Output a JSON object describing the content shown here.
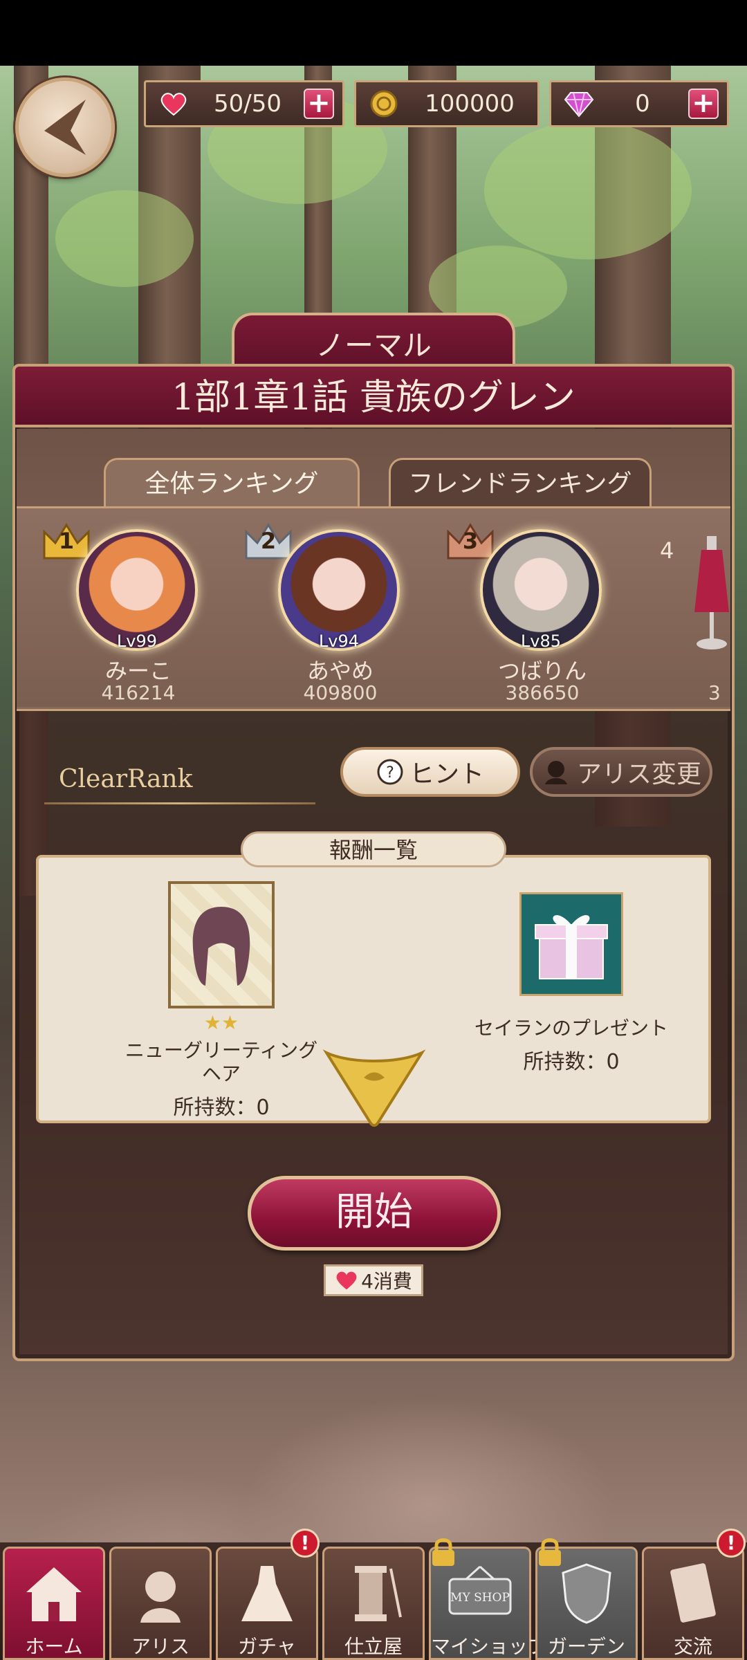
{
  "header": {
    "stamina": "50/50",
    "coins": "100000",
    "gems": "0"
  },
  "stage": {
    "difficulty": "ノーマル",
    "title": "1部1章1話 貴族のグレン"
  },
  "ranking": {
    "tabs": [
      "全体ランキング",
      "フレンドランキング"
    ],
    "players": [
      {
        "rank": "1",
        "level": "Lv99",
        "name": "みーこ",
        "score": "416214"
      },
      {
        "rank": "2",
        "level": "Lv94",
        "name": "あやめ",
        "score": "409800"
      },
      {
        "rank": "3",
        "level": "Lv85",
        "name": "つばりん",
        "score": "386650"
      },
      {
        "rank": "4",
        "level": "",
        "name": "",
        "score": "3"
      }
    ]
  },
  "clear_rank_label": "ClearRank",
  "buttons": {
    "hint": "ヒント",
    "alice_change": "アリス変更",
    "start": "開始",
    "cost": "4消費"
  },
  "rewards": {
    "label": "報酬一覧",
    "items": [
      {
        "name": "ニューグリーティングヘア",
        "stars": "★★",
        "owned": "所持数：0"
      },
      {
        "name": "セイランのプレゼント",
        "owned": "所持数：0"
      }
    ]
  },
  "nav": {
    "items": [
      {
        "label": "ホーム"
      },
      {
        "label": "アリス"
      },
      {
        "label": "ガチャ",
        "badge": "!"
      },
      {
        "label": "仕立屋"
      },
      {
        "label": "マイショップ",
        "sign": "MY SHOP"
      },
      {
        "label": "ガーデン"
      },
      {
        "label": "交流",
        "badge": "!"
      }
    ]
  }
}
